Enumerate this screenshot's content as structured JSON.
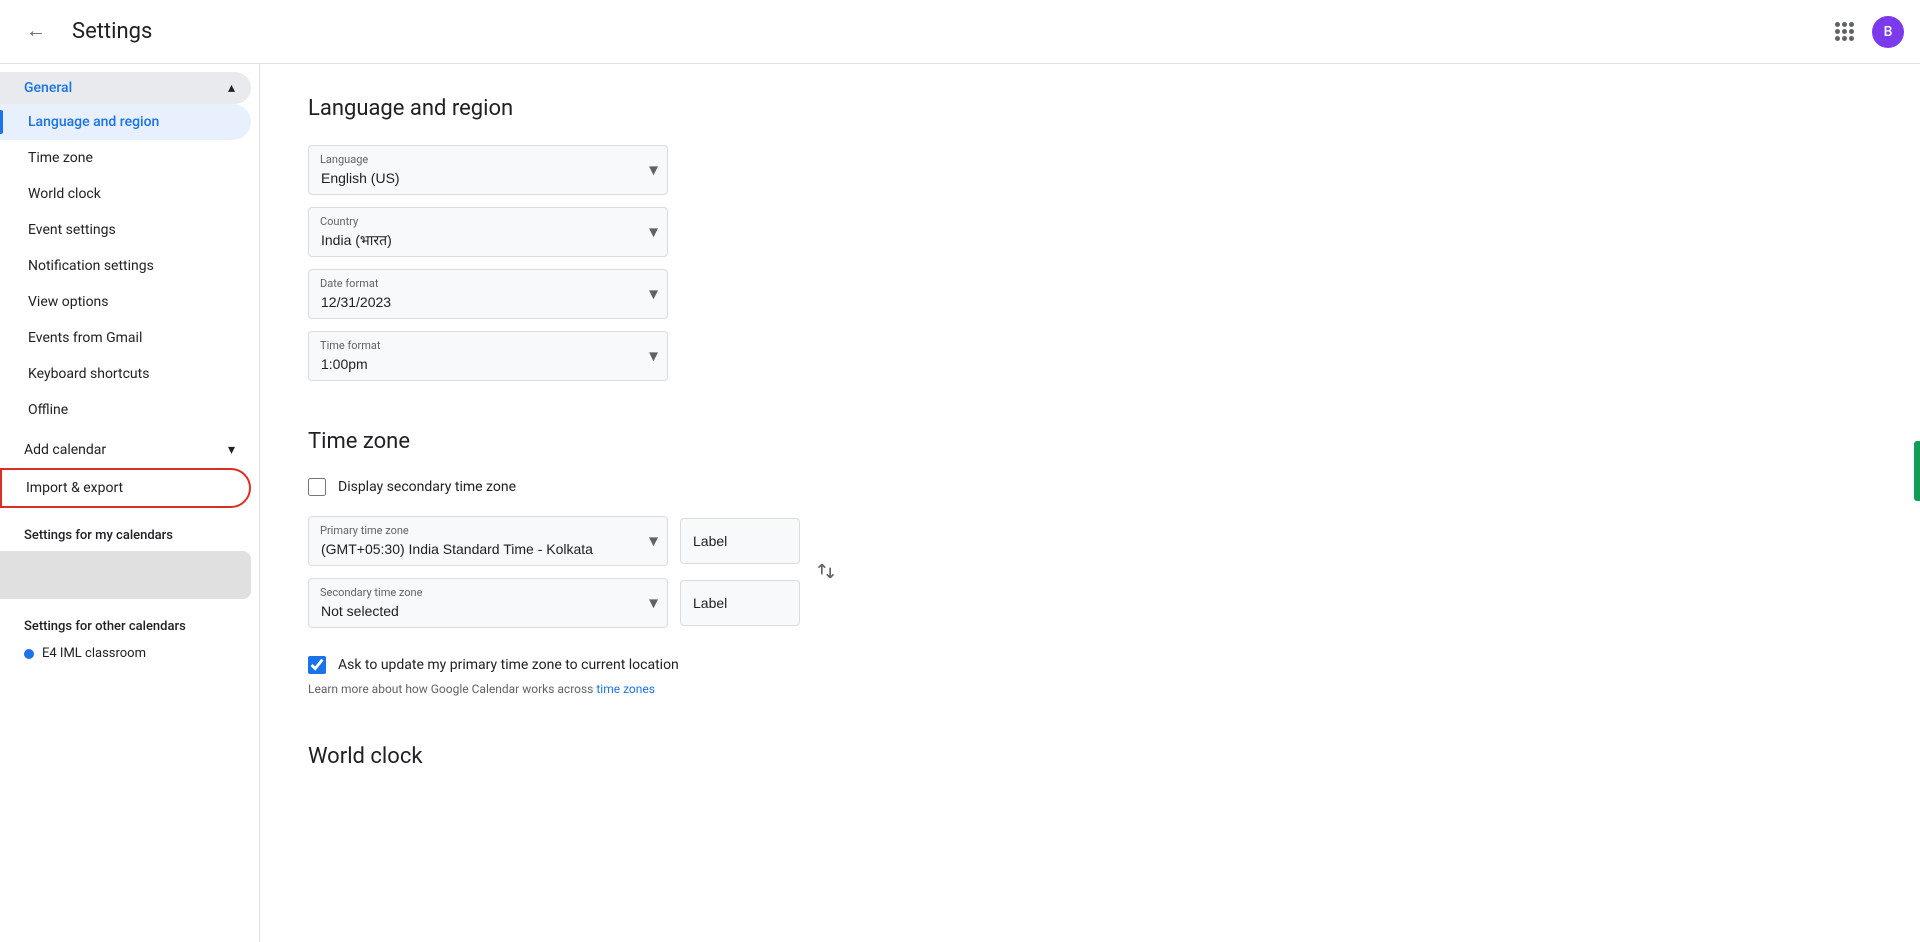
{
  "topbar": {
    "back_label": "←",
    "title": "Settings",
    "avatar_label": "B",
    "avatar_color": "#7c3aed"
  },
  "sidebar": {
    "general_label": "General",
    "items": [
      {
        "id": "language-region",
        "label": "Language and region",
        "active": true
      },
      {
        "id": "time-zone",
        "label": "Time zone",
        "active": false
      },
      {
        "id": "world-clock",
        "label": "World clock",
        "active": false
      },
      {
        "id": "event-settings",
        "label": "Event settings",
        "active": false
      },
      {
        "id": "notification-settings",
        "label": "Notification settings",
        "active": false
      },
      {
        "id": "view-options",
        "label": "View options",
        "active": false
      },
      {
        "id": "events-from-gmail",
        "label": "Events from Gmail",
        "active": false
      },
      {
        "id": "keyboard-shortcuts",
        "label": "Keyboard shortcuts",
        "active": false
      },
      {
        "id": "offline",
        "label": "Offline",
        "active": false
      }
    ],
    "add_calendar_label": "Add calendar",
    "import_export_label": "Import & export",
    "settings_my_calendars": "Settings for my calendars",
    "settings_other_calendars": "Settings for other calendars",
    "other_calendar_items": [
      {
        "label": "E4 IML classroom",
        "color": "#1a73e8"
      }
    ]
  },
  "main": {
    "language_section": {
      "title": "Language and region",
      "language_label": "Language",
      "language_value": "English (US)",
      "country_label": "Country",
      "country_value": "India (भारत)",
      "date_format_label": "Date format",
      "date_format_value": "12/31/2023",
      "time_format_label": "Time format",
      "time_format_value": "1:00pm"
    },
    "timezone_section": {
      "title": "Time zone",
      "display_secondary_label": "Display secondary time zone",
      "primary_label": "Primary time zone",
      "primary_value": "(GMT+05:30) India Standard Time - Kolkata",
      "primary_input_label": "Label",
      "secondary_label": "Secondary time zone",
      "secondary_value": "Not selected",
      "secondary_input_label": "Label",
      "ask_update_label": "Ask to update my primary time zone to current location",
      "learn_more_text": "Learn more about how Google Calendar works across ",
      "time_zones_link": "time zones"
    },
    "world_clock_section": {
      "title": "World clock"
    }
  }
}
